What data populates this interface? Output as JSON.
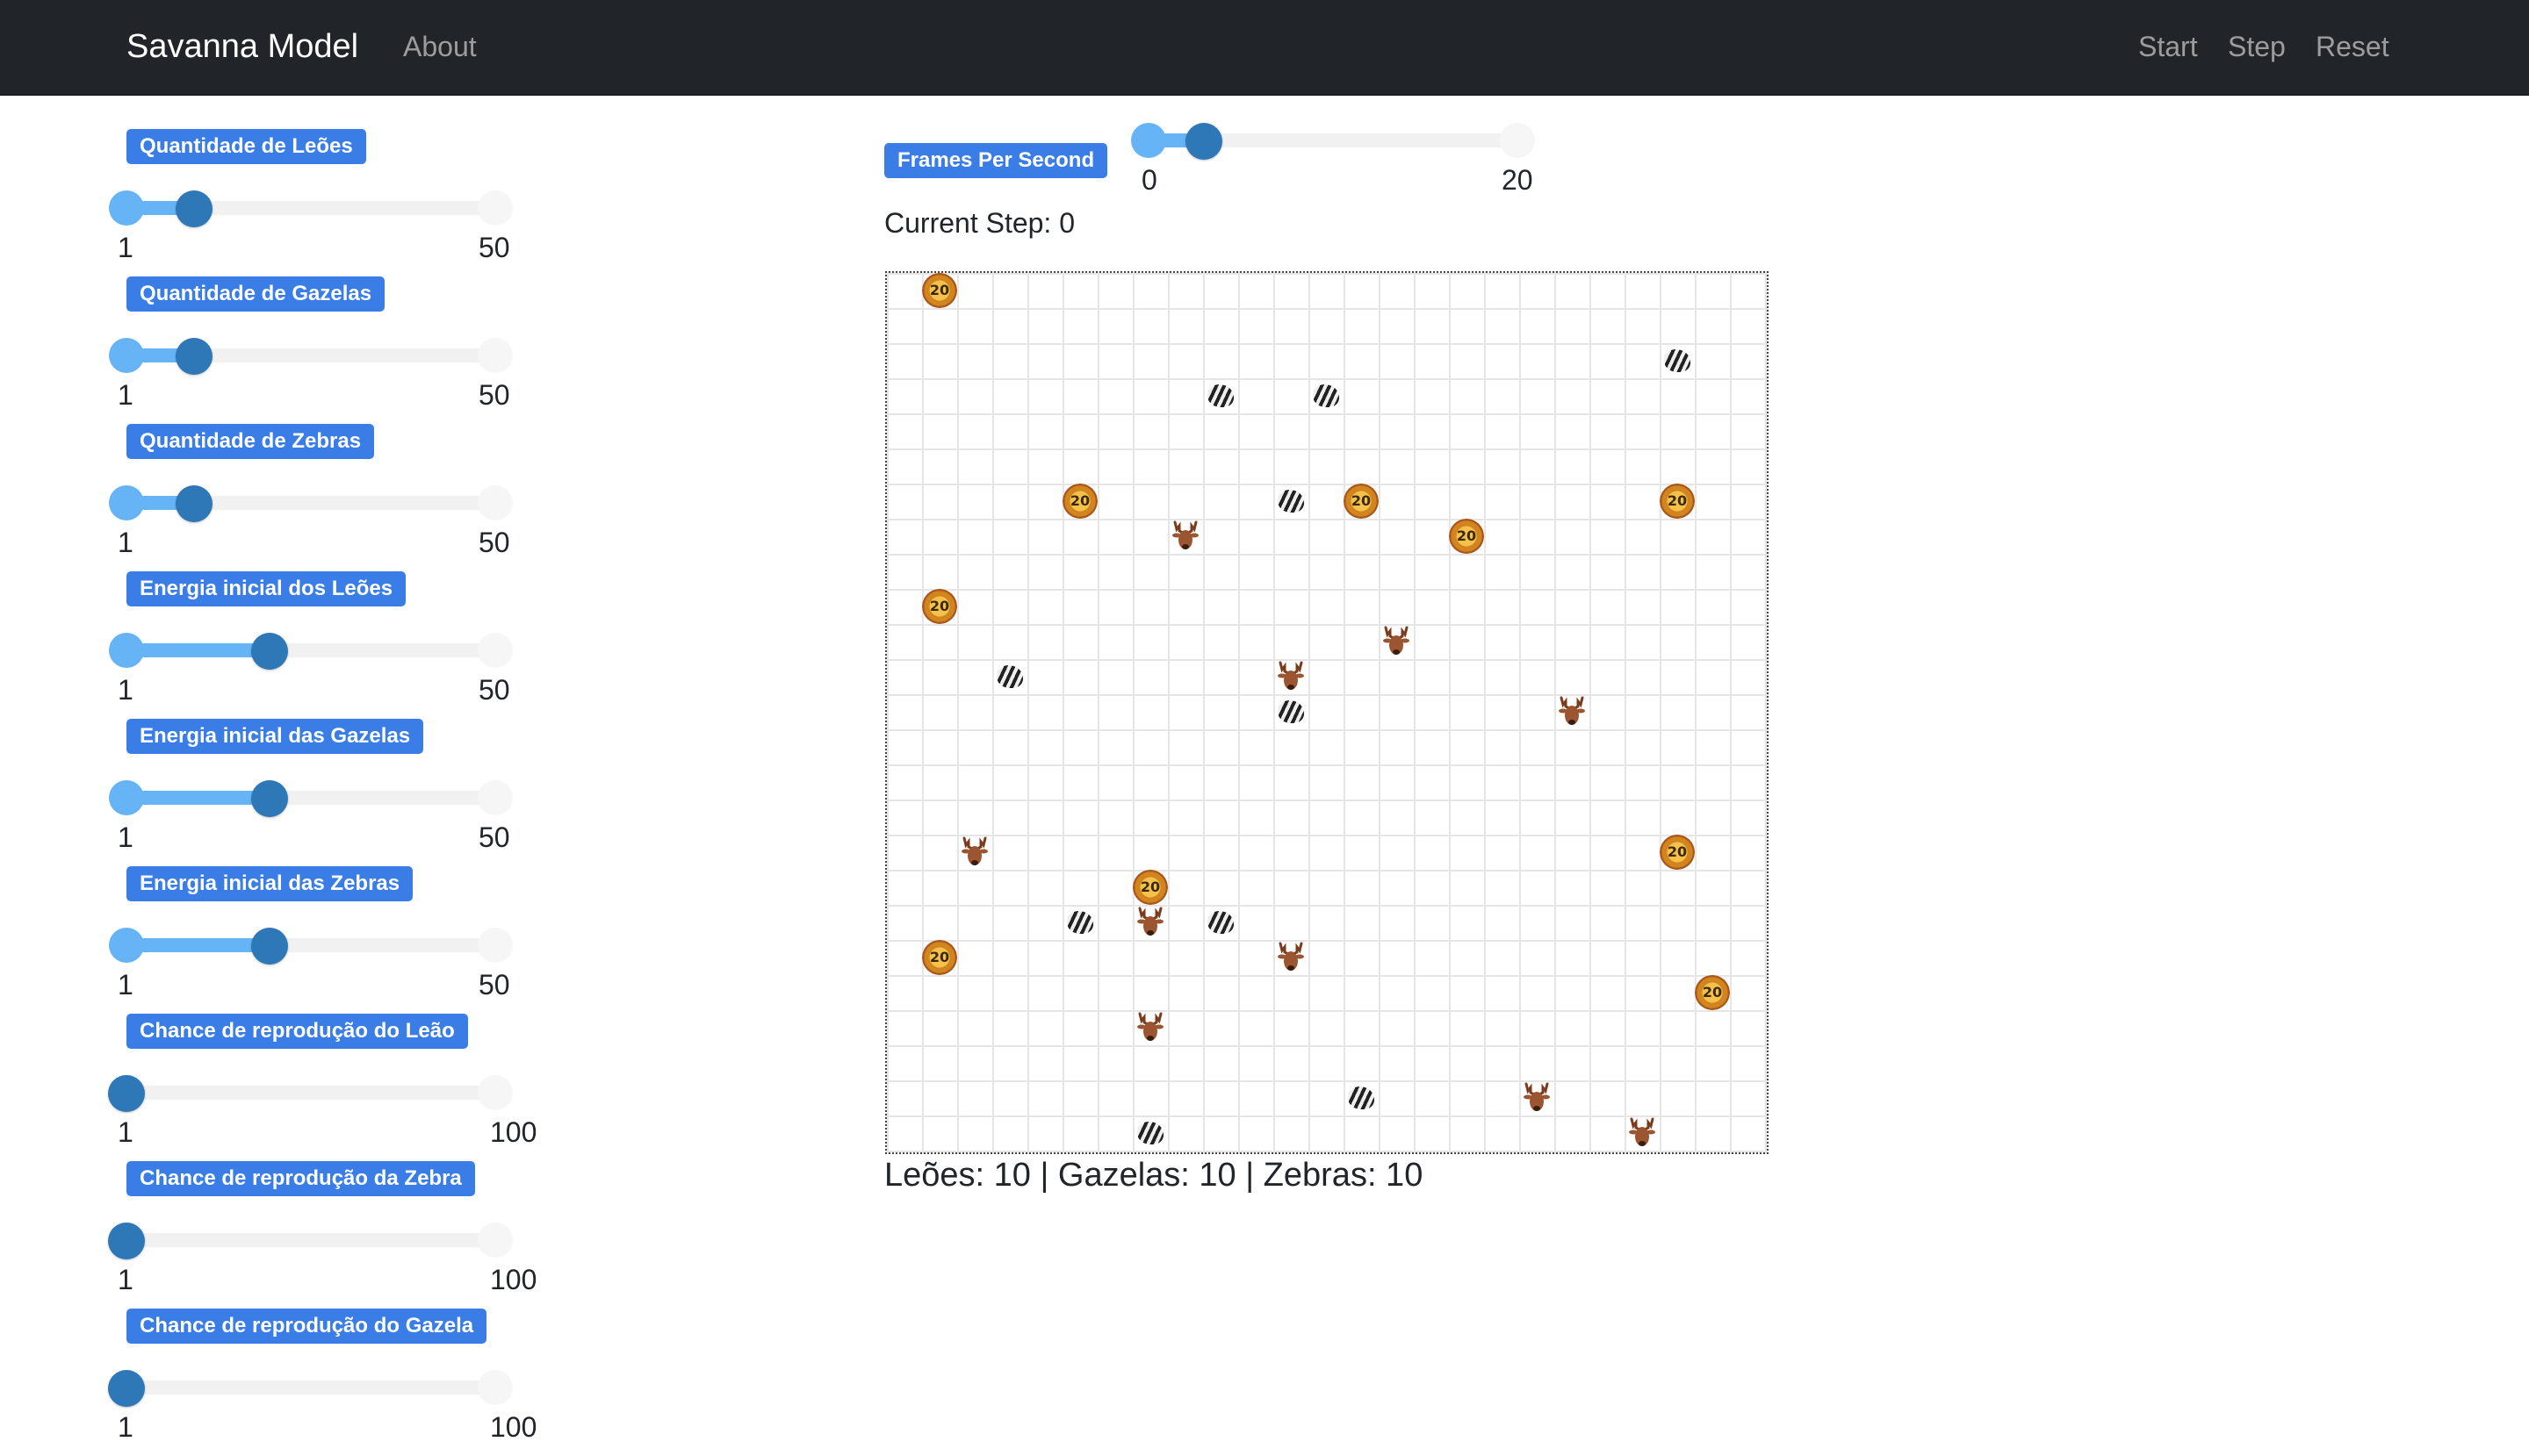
{
  "navbar": {
    "brand": "Savanna Model",
    "about": "About",
    "start": "Start",
    "step": "Step",
    "reset": "Reset"
  },
  "params": [
    {
      "label": "Quantidade de Leões",
      "min": "1",
      "max": "50",
      "value": 10
    },
    {
      "label": "Quantidade de Gazelas",
      "min": "1",
      "max": "50",
      "value": 10
    },
    {
      "label": "Quantidade de Zebras",
      "min": "1",
      "max": "50",
      "value": 10
    },
    {
      "label": "Energia inicial dos Leões",
      "min": "1",
      "max": "50",
      "value": 20
    },
    {
      "label": "Energia inicial das Gazelas",
      "min": "1",
      "max": "50",
      "value": 20
    },
    {
      "label": "Energia inicial das Zebras",
      "min": "1",
      "max": "50",
      "value": 20
    },
    {
      "label": "Chance de reprodução do Leão",
      "min": "1",
      "max": "100",
      "value": 1
    },
    {
      "label": "Chance de reprodução da Zebra",
      "min": "1",
      "max": "100",
      "value": 1
    },
    {
      "label": "Chance de reprodução do Gazela",
      "min": "1",
      "max": "100",
      "value": 1
    }
  ],
  "fps": {
    "label": "Frames Per Second",
    "min": "0",
    "max": "20",
    "value": 3
  },
  "current_step": "Current Step: 0",
  "counts": "Leões: 10 | Gazelas: 10 | Zebras: 10",
  "grid": {
    "columns": 25,
    "rows": 25,
    "agents": [
      {
        "type": "lion",
        "col": 1,
        "row": 0
      },
      {
        "type": "lion",
        "col": 5,
        "row": 6
      },
      {
        "type": "lion",
        "col": 13,
        "row": 6
      },
      {
        "type": "lion",
        "col": 22,
        "row": 6
      },
      {
        "type": "lion",
        "col": 16,
        "row": 7
      },
      {
        "type": "lion",
        "col": 1,
        "row": 9
      },
      {
        "type": "lion",
        "col": 22,
        "row": 16
      },
      {
        "type": "lion",
        "col": 7,
        "row": 17
      },
      {
        "type": "lion",
        "col": 1,
        "row": 19
      },
      {
        "type": "lion",
        "col": 23,
        "row": 20
      },
      {
        "type": "zebra",
        "col": 22,
        "row": 2
      },
      {
        "type": "zebra",
        "col": 9,
        "row": 3
      },
      {
        "type": "zebra",
        "col": 12,
        "row": 3
      },
      {
        "type": "zebra",
        "col": 11,
        "row": 6
      },
      {
        "type": "zebra",
        "col": 3,
        "row": 11
      },
      {
        "type": "zebra",
        "col": 11,
        "row": 12
      },
      {
        "type": "zebra",
        "col": 5,
        "row": 18
      },
      {
        "type": "zebra",
        "col": 9,
        "row": 18
      },
      {
        "type": "zebra",
        "col": 13,
        "row": 23
      },
      {
        "type": "zebra",
        "col": 7,
        "row": 24
      },
      {
        "type": "gazelle",
        "col": 8,
        "row": 7
      },
      {
        "type": "gazelle",
        "col": 14,
        "row": 10
      },
      {
        "type": "gazelle",
        "col": 11,
        "row": 11
      },
      {
        "type": "gazelle",
        "col": 19,
        "row": 12
      },
      {
        "type": "gazelle",
        "col": 2,
        "row": 16
      },
      {
        "type": "gazelle",
        "col": 7,
        "row": 18
      },
      {
        "type": "gazelle",
        "col": 11,
        "row": 19
      },
      {
        "type": "gazelle",
        "col": 7,
        "row": 21
      },
      {
        "type": "gazelle",
        "col": 18,
        "row": 23
      },
      {
        "type": "gazelle",
        "col": 21,
        "row": 24
      }
    ]
  }
}
